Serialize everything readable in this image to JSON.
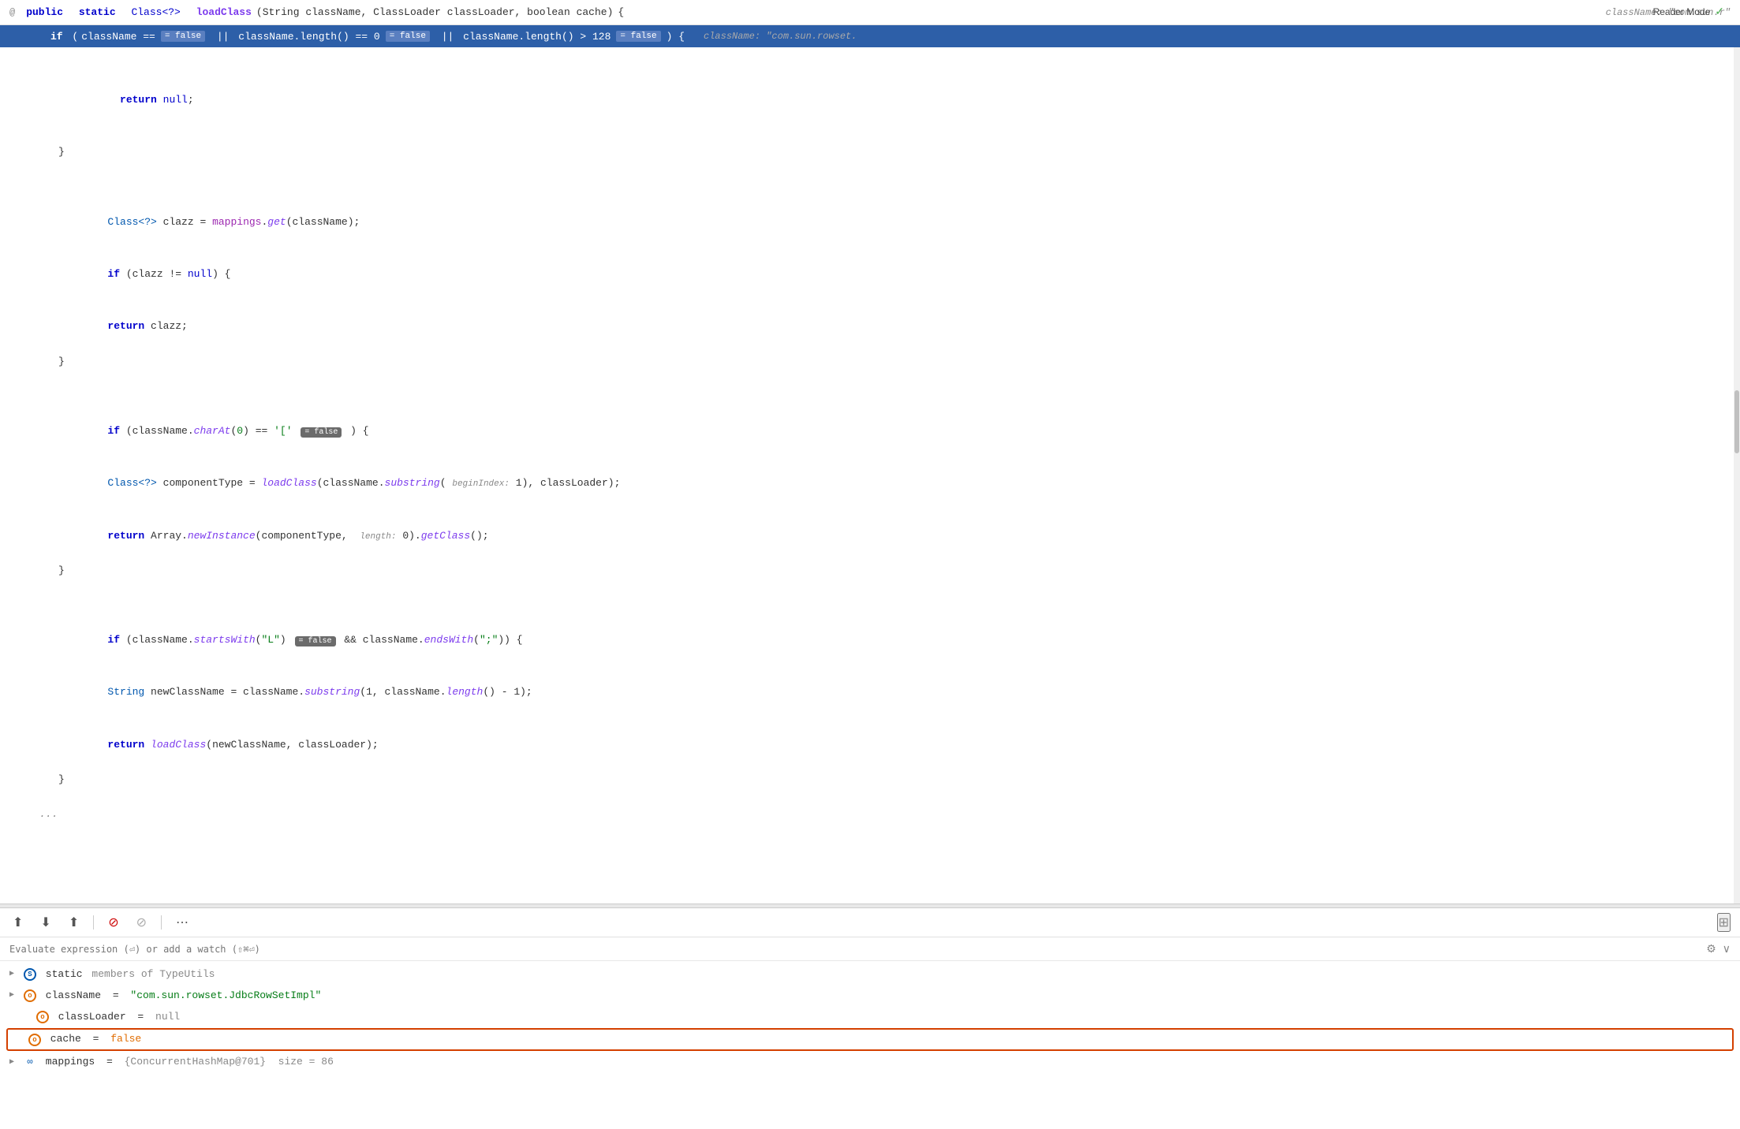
{
  "header": {
    "gutter": "@",
    "signature": {
      "public": "public",
      "static": "static",
      "return_type": "Class<?>",
      "method": "loadClass",
      "params": "(String className, ClassLoader classLoader, boolean cache)",
      "open_brace": "{",
      "hint": "className: \"com.sun.r\""
    },
    "reader_mode": "Reader Mode",
    "reader_check": "✓"
  },
  "highlighted_line": {
    "kw_if": "if",
    "cond_start": "(className ==",
    "badge1": "= false",
    "or1": "||",
    "mid": "className.length() == 0",
    "badge2": "= false",
    "or2": "||",
    "end_cond": "className.length() > 128",
    "badge3": "= false",
    "close": ") {",
    "hint": "className: \"com.sun.rowset."
  },
  "code_lines": [
    {
      "indent": 2,
      "text": "return null;"
    },
    {
      "indent": 1,
      "text": "}"
    },
    {
      "indent": 0,
      "text": ""
    },
    {
      "indent": 0,
      "text": ""
    },
    {
      "indent": 1,
      "text": "Class<?> clazz = mappings.get(className);"
    },
    {
      "indent": 1,
      "text": "if (clazz != null) {"
    },
    {
      "indent": 2,
      "text": "return clazz;"
    },
    {
      "indent": 1,
      "text": "}"
    },
    {
      "indent": 0,
      "text": ""
    },
    {
      "indent": 0,
      "text": ""
    },
    {
      "indent": 1,
      "text": "if (className.charAt(0) == '['"
    },
    {
      "indent": 2,
      "text": "Class<?> componentType = loadClass(className.substring( beginIndex: 1), classLoader);"
    },
    {
      "indent": 2,
      "text": "return Array.newInstance(componentType,  length: 0).getClass();"
    },
    {
      "indent": 1,
      "text": "}"
    },
    {
      "indent": 0,
      "text": ""
    },
    {
      "indent": 0,
      "text": ""
    },
    {
      "indent": 1,
      "text": "if (className.startsWith(\"L\")"
    },
    {
      "indent": 2,
      "text": "String newClassName = className.substring(1, className.length() - 1);"
    },
    {
      "indent": 2,
      "text": "return loadClass(newClassName, classLoader);"
    },
    {
      "indent": 1,
      "text": "}"
    },
    {
      "indent": 0,
      "text": ""
    },
    {
      "indent": 0,
      "text": "..."
    }
  ],
  "debug_toolbar": {
    "btn_download_top": "⬇",
    "btn_download": "↓",
    "btn_upload": "↑",
    "btn_record_stop": "⊘",
    "btn_cancel": "⊘",
    "btn_more": "⋯",
    "btn_layout": "⊞"
  },
  "evaluate_bar": {
    "placeholder": "Evaluate expression (⏎) or add a watch (⇧⌘⏎)",
    "settings_icon": "⚙",
    "expand_icon": "∨"
  },
  "variables": [
    {
      "id": "var-static",
      "expandable": true,
      "icon": "S",
      "icon_type": "blue",
      "name": "static",
      "eq": "",
      "value": "members of TypeUtils",
      "value_type": "gray",
      "indent": 0
    },
    {
      "id": "var-classname",
      "expandable": true,
      "icon": "o",
      "icon_type": "orange",
      "name": "className",
      "eq": "=",
      "value": "\"com.sun.rowset.JdbcRowSetImpl\"",
      "value_type": "green",
      "indent": 0
    },
    {
      "id": "var-classloader",
      "expandable": false,
      "icon": "o",
      "icon_type": "orange",
      "name": "classLoader",
      "eq": "=",
      "value": "null",
      "value_type": "gray",
      "indent": 0
    },
    {
      "id": "var-cache",
      "expandable": false,
      "icon": "o",
      "icon_type": "orange",
      "name": "cache",
      "eq": "=",
      "value": "false",
      "value_type": "orange",
      "indent": 0,
      "highlighted": true
    },
    {
      "id": "var-mappings",
      "expandable": true,
      "icon": "∞",
      "icon_type": "squiggle",
      "name": "mappings",
      "eq": "=",
      "value": "{ConcurrentHashMap@701}  size = 86",
      "value_type": "gray",
      "indent": 0
    }
  ]
}
